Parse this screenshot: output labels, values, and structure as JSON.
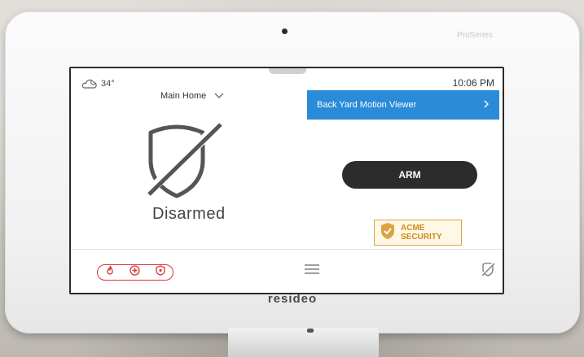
{
  "device": {
    "series_label": "ProSeries",
    "brand": "resideo"
  },
  "screen": {
    "weather": {
      "icon": "cloud-moon-icon",
      "temperature": "34°"
    },
    "time": "10:06 PM",
    "location": {
      "label": "Main Home",
      "icon": "chevron-down-icon"
    },
    "status": {
      "icon": "shield-disarmed-icon",
      "label": "Disarmed"
    },
    "camera_viewer": {
      "label": "Back Yard Motion Viewer",
      "icon": "chevron-right-icon"
    },
    "arm_button": {
      "label": "ARM"
    },
    "dealer_logo": {
      "line1": "ACME",
      "line2": "SECURITY"
    },
    "bottom_bar": {
      "panic_icons": [
        "fire-icon",
        "medical-icon",
        "police-icon"
      ],
      "menu_icon": "hamburger-menu-icon",
      "status_icon": "disarmed-status-icon"
    }
  },
  "colors": {
    "accent_blue": "#2a8bd9",
    "button_dark": "#2c2c2c",
    "panic_red": "#d93535",
    "dealer_gold": "#d9a441"
  }
}
